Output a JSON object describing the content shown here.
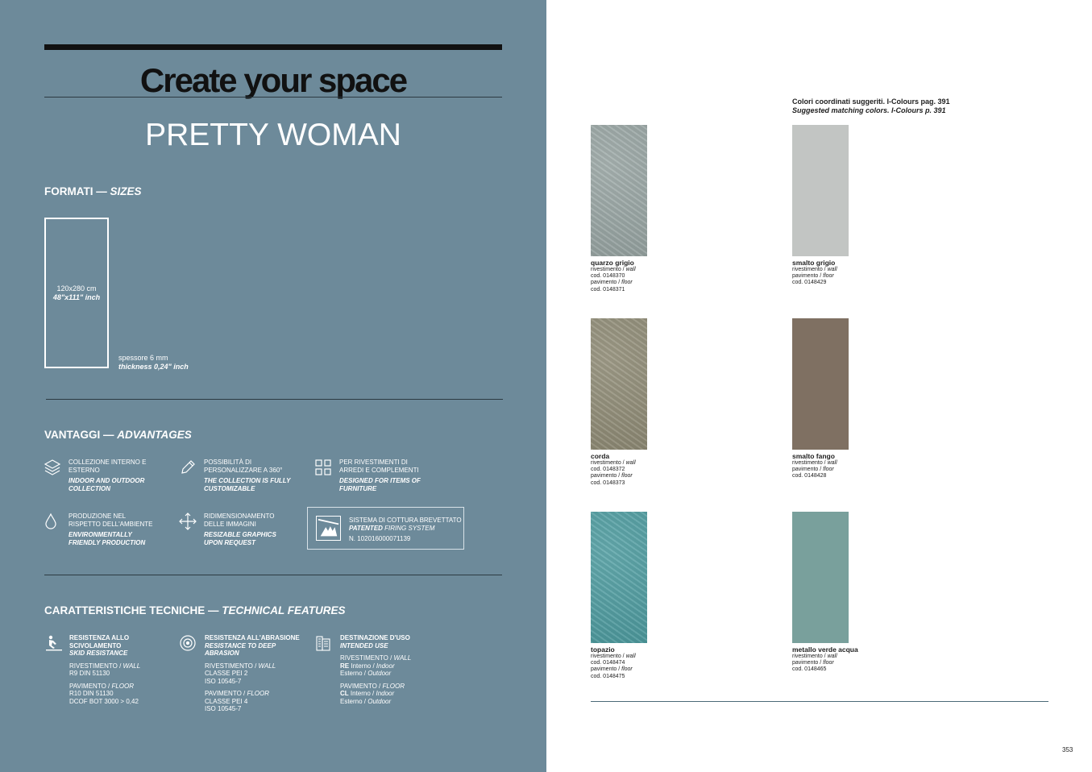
{
  "left": {
    "title": "Create your space",
    "subtitle": "PRETTY WOMAN",
    "sizes": {
      "heading": "FORMATI — ",
      "heading_it": "SIZES",
      "size_cm": "120x280 cm",
      "size_inch": "48\"x111\" inch",
      "thickness": "spessore 6 mm",
      "thickness_inch": "thickness 0,24\" inch"
    },
    "advantages": {
      "heading": "VANTAGGI — ",
      "heading_it": "ADVANTAGES",
      "items": [
        {
          "icon": "layers-icon",
          "text": "COLLEZIONE INTERNO E ESTERNO",
          "text_en": "INDOOR AND OUTDOOR COLLECTION"
        },
        {
          "icon": "pencil-icon",
          "text": "POSSIBILITÀ DI PERSONALIZZARE A 360°",
          "text_en": "THE COLLECTION IS FULLY CUSTOMIZABLE"
        },
        {
          "icon": "grid-icon",
          "text": "PER RIVESTIMENTI DI ARREDI E COMPLEMENTI",
          "text_en": "DESIGNED FOR ITEMS OF FURNITURE"
        },
        {
          "icon": "drop-icon",
          "text": "PRODUZIONE NEL RISPETTO DELL'AMBIENTE",
          "text_en": "ENVIRONMENTALLY FRIENDLY PRODUCTION"
        },
        {
          "icon": "move-arrows-icon",
          "text": "RIDIMENSIONAMENTO DELLE IMMAGINI",
          "text_en": "RESIZABLE GRAPHICS UPON REQUEST"
        }
      ],
      "patent": {
        "line1": "SISTEMA DI COTTURA BREVETTATO",
        "line2a": "PATENTED ",
        "line2b": "FIRING SYSTEM",
        "line3": "N. 102016000071139"
      }
    },
    "technical": {
      "heading": "CARATTERISTICHE TECNICHE — ",
      "heading_it": "TECHNICAL FEATURES",
      "cols": [
        {
          "icon": "slip-icon",
          "title": "RESISTENZA ALLO SCIVOLAMENTO",
          "title_en": "SKID RESISTANCE",
          "b1": [
            "RIVESTIMENTO / ",
            "WALL",
            "R9 DIN 51130"
          ],
          "b2": [
            "PAVIMENTO / ",
            "FLOOR",
            "R10 DIN 51130",
            "DCOF BOT 3000 > 0,42"
          ]
        },
        {
          "icon": "abrasion-icon",
          "title": "RESISTENZA ALL'ABRASIONE",
          "title_en": "RESISTANCE TO DEEP ABRASION",
          "b1": [
            "RIVESTIMENTO / ",
            "WALL",
            "CLASSE PEI 2",
            "ISO 10545-7"
          ],
          "b2": [
            "PAVIMENTO / ",
            "FLOOR",
            "CLASSE PEI 4",
            "ISO 10545-7"
          ]
        },
        {
          "icon": "building-icon",
          "title": "DESTINAZIONE D'USO",
          "title_en": "INTENDED USE",
          "b1": [
            "RIVESTIMENTO / ",
            "WALL",
            "RE",
            " Interno / ",
            "Indoor",
            "Esterno / ",
            "Outdoor"
          ],
          "b2": [
            "PAVIMENTO / ",
            "FLOOR",
            "CL",
            " Interno / ",
            "Indoor",
            "Esterno / ",
            "Outdoor"
          ]
        }
      ]
    }
  },
  "right": {
    "colors_head": "Colori coordinati suggeriti. I-Colours pag. 391",
    "colors_head_en": "Suggested matching colors. I-Colours p. 391",
    "swatches": [
      {
        "name": "quarzo grigio",
        "color": "#9aa7a5",
        "lines": [
          [
            "rivestimento / ",
            "wall"
          ],
          [
            "cod. 0148370",
            ""
          ],
          [
            "pavimento / ",
            "floor"
          ],
          [
            "cod. 0148371",
            ""
          ]
        ]
      },
      {
        "name": "smalto grigio",
        "color": "#c2c5c3",
        "lines": [
          [
            "rivestimento / ",
            "wall"
          ],
          [
            "pavimento / ",
            "floor"
          ],
          [
            "cod. 0148429",
            ""
          ]
        ]
      },
      {
        "name": "corda",
        "color": "#918d77",
        "lines": [
          [
            "rivestimento / ",
            "wall"
          ],
          [
            "cod. 0148372",
            ""
          ],
          [
            "pavimento / ",
            "floor"
          ],
          [
            "cod. 0148373",
            ""
          ]
        ]
      },
      {
        "name": "smalto fango",
        "color": "#7f7062",
        "lines": [
          [
            "rivestimento / ",
            "wall"
          ],
          [
            "pavimento / ",
            "floor"
          ],
          [
            "cod. 0148428",
            ""
          ]
        ]
      },
      {
        "name": "topazio",
        "color": "#4f9ea2",
        "lines": [
          [
            "rivestimento / ",
            "wall"
          ],
          [
            "cod. 0148474",
            ""
          ],
          [
            "pavimento / ",
            "floor"
          ],
          [
            "cod. 0148475",
            ""
          ]
        ]
      },
      {
        "name": "metallo verde acqua",
        "color": "#79a09c",
        "lines": [
          [
            "rivestimento / ",
            "wall"
          ],
          [
            "pavimento / ",
            "floor"
          ],
          [
            "cod. 0148465",
            ""
          ]
        ]
      }
    ],
    "page_number": "353"
  }
}
